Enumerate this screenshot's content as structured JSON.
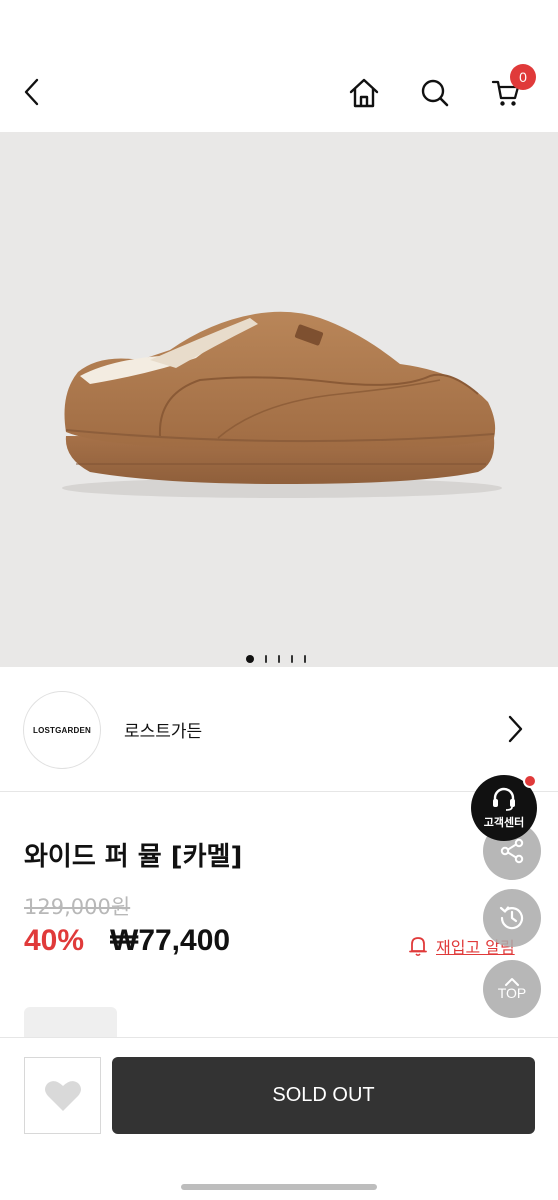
{
  "header": {
    "back_icon": "chevron-left-icon",
    "home_icon": "home-icon",
    "search_icon": "search-icon",
    "cart_icon": "cart-icon",
    "cart_count": "0"
  },
  "gallery": {
    "image": "camel suede slipper with fur lining",
    "total_slides": 5,
    "current_slide": 1
  },
  "brand": {
    "logo_text": "LOSTGARDEN",
    "name": "로스트가든",
    "chevron_icon": "chevron-right-icon"
  },
  "product": {
    "title": "와이드 퍼 뮬 [카멜]",
    "original_price": "129,000원",
    "discount": "40%",
    "sale_price": "₩77,400",
    "restock_label": "재입고 알림",
    "restock_icon": "bell-icon"
  },
  "floating": {
    "customer_center_label": "고객센터",
    "customer_center_icon": "headset-icon",
    "share_icon": "share-icon",
    "history_icon": "history-icon",
    "top_label": "TOP",
    "top_icon": "chevron-up-icon"
  },
  "bottom_bar": {
    "wishlist_icon": "heart-icon",
    "soldout_label": "SOLD OUT"
  },
  "colors": {
    "accent": "#e03a3a",
    "button_dark": "#333333",
    "image_bg": "#e9e8e7"
  }
}
